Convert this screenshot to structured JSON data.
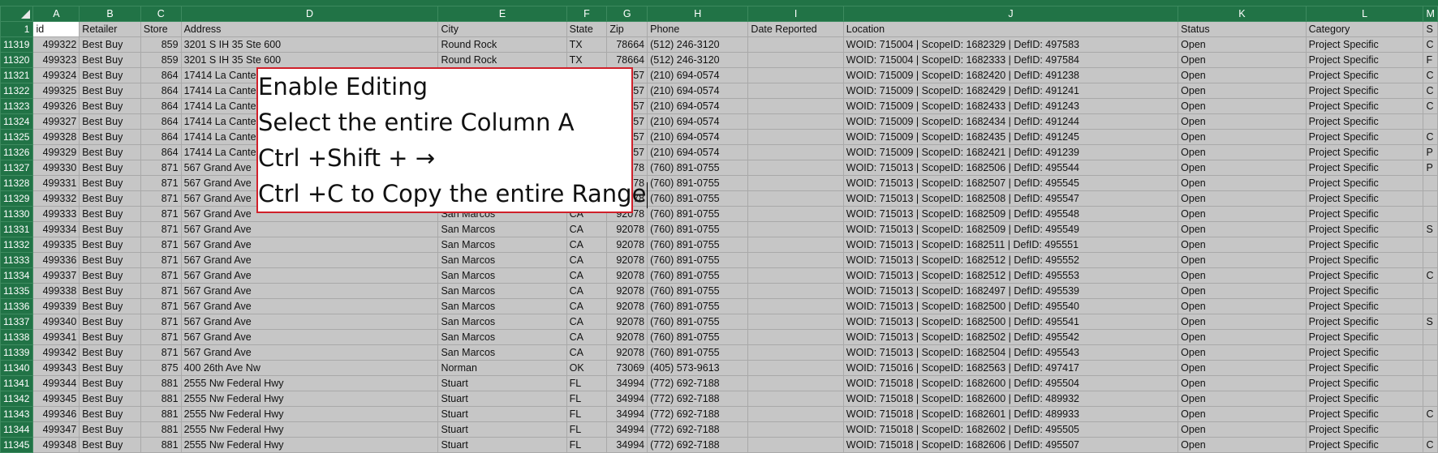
{
  "corner_label": "",
  "columns": [
    "A",
    "B",
    "C",
    "D",
    "E",
    "F",
    "G",
    "H",
    "I",
    "J",
    "K",
    "L",
    "M"
  ],
  "header_row": {
    "row_number": "1",
    "cells": [
      "id",
      "Retailer",
      "Store",
      "Address",
      "City",
      "State",
      "Zip",
      "Phone",
      "Date Reported",
      "Location",
      "Status",
      "Category",
      "S"
    ]
  },
  "rows": [
    {
      "row": "11319",
      "cells": [
        "499322",
        "Best Buy",
        "859",
        "3201 S IH 35 Ste 600",
        "Round Rock",
        "TX",
        "78664",
        "(512) 246-3120",
        "",
        "WOID: 715004 | ScopeID: 1682329 | DefID: 497583",
        "Open",
        "Project Specific",
        "C"
      ]
    },
    {
      "row": "11320",
      "cells": [
        "499323",
        "Best Buy",
        "859",
        "3201 S IH 35 Ste 600",
        "Round Rock",
        "TX",
        "78664",
        "(512) 246-3120",
        "",
        "WOID: 715004 | ScopeID: 1682333 | DefID: 497584",
        "Open",
        "Project Specific",
        "F"
      ]
    },
    {
      "row": "11321",
      "cells": [
        "499324",
        "Best Buy",
        "864",
        "17414 La Cantera",
        "",
        "",
        "78257",
        "(210) 694-0574",
        "",
        "WOID: 715009 | ScopeID: 1682420 | DefID: 491238",
        "Open",
        "Project Specific",
        "C"
      ]
    },
    {
      "row": "11322",
      "cells": [
        "499325",
        "Best Buy",
        "864",
        "17414 La Cantera",
        "",
        "",
        "78257",
        "(210) 694-0574",
        "",
        "WOID: 715009 | ScopeID: 1682429 | DefID: 491241",
        "Open",
        "Project Specific",
        "C"
      ]
    },
    {
      "row": "11323",
      "cells": [
        "499326",
        "Best Buy",
        "864",
        "17414 La Cantera",
        "",
        "",
        "78257",
        "(210) 694-0574",
        "",
        "WOID: 715009 | ScopeID: 1682433 | DefID: 491243",
        "Open",
        "Project Specific",
        "C"
      ]
    },
    {
      "row": "11324",
      "cells": [
        "499327",
        "Best Buy",
        "864",
        "17414 La Cantera",
        "",
        "",
        "78257",
        "(210) 694-0574",
        "",
        "WOID: 715009 | ScopeID: 1682434 | DefID: 491244",
        "Open",
        "Project Specific",
        ""
      ]
    },
    {
      "row": "11325",
      "cells": [
        "499328",
        "Best Buy",
        "864",
        "17414 La Cantera",
        "",
        "",
        "78257",
        "(210) 694-0574",
        "",
        "WOID: 715009 | ScopeID: 1682435 | DefID: 491245",
        "Open",
        "Project Specific",
        "C"
      ]
    },
    {
      "row": "11326",
      "cells": [
        "499329",
        "Best Buy",
        "864",
        "17414 La Cantera",
        "",
        "",
        "78257",
        "(210) 694-0574",
        "",
        "WOID: 715009 | ScopeID: 1682421 | DefID: 491239",
        "Open",
        "Project Specific",
        "P"
      ]
    },
    {
      "row": "11327",
      "cells": [
        "499330",
        "Best Buy",
        "871",
        "567 Grand Ave",
        "",
        "",
        "92078",
        "(760) 891-0755",
        "",
        "WOID: 715013 | ScopeID: 1682506 | DefID: 495544",
        "Open",
        "Project Specific",
        "P"
      ]
    },
    {
      "row": "11328",
      "cells": [
        "499331",
        "Best Buy",
        "871",
        "567 Grand Ave",
        "",
        "",
        "92078",
        "(760) 891-0755",
        "",
        "WOID: 715013 | ScopeID: 1682507 | DefID: 495545",
        "Open",
        "Project Specific",
        ""
      ]
    },
    {
      "row": "11329",
      "cells": [
        "499332",
        "Best Buy",
        "871",
        "567 Grand Ave",
        "",
        "",
        "92078",
        "(760) 891-0755",
        "",
        "WOID: 715013 | ScopeID: 1682508 | DefID: 495547",
        "Open",
        "Project Specific",
        ""
      ]
    },
    {
      "row": "11330",
      "cells": [
        "499333",
        "Best Buy",
        "871",
        "567 Grand Ave",
        "San Marcos",
        "CA",
        "92078",
        "(760) 891-0755",
        "",
        "WOID: 715013 | ScopeID: 1682509 | DefID: 495548",
        "Open",
        "Project Specific",
        ""
      ]
    },
    {
      "row": "11331",
      "cells": [
        "499334",
        "Best Buy",
        "871",
        "567 Grand Ave",
        "San Marcos",
        "CA",
        "92078",
        "(760) 891-0755",
        "",
        "WOID: 715013 | ScopeID: 1682509 | DefID: 495549",
        "Open",
        "Project Specific",
        "S"
      ]
    },
    {
      "row": "11332",
      "cells": [
        "499335",
        "Best Buy",
        "871",
        "567 Grand Ave",
        "San Marcos",
        "CA",
        "92078",
        "(760) 891-0755",
        "",
        "WOID: 715013 | ScopeID: 1682511 | DefID: 495551",
        "Open",
        "Project Specific",
        ""
      ]
    },
    {
      "row": "11333",
      "cells": [
        "499336",
        "Best Buy",
        "871",
        "567 Grand Ave",
        "San Marcos",
        "CA",
        "92078",
        "(760) 891-0755",
        "",
        "WOID: 715013 | ScopeID: 1682512 | DefID: 495552",
        "Open",
        "Project Specific",
        ""
      ]
    },
    {
      "row": "11334",
      "cells": [
        "499337",
        "Best Buy",
        "871",
        "567 Grand Ave",
        "San Marcos",
        "CA",
        "92078",
        "(760) 891-0755",
        "",
        "WOID: 715013 | ScopeID: 1682512 | DefID: 495553",
        "Open",
        "Project Specific",
        "C"
      ]
    },
    {
      "row": "11335",
      "cells": [
        "499338",
        "Best Buy",
        "871",
        "567 Grand Ave",
        "San Marcos",
        "CA",
        "92078",
        "(760) 891-0755",
        "",
        "WOID: 715013 | ScopeID: 1682497 | DefID: 495539",
        "Open",
        "Project Specific",
        ""
      ]
    },
    {
      "row": "11336",
      "cells": [
        "499339",
        "Best Buy",
        "871",
        "567 Grand Ave",
        "San Marcos",
        "CA",
        "92078",
        "(760) 891-0755",
        "",
        "WOID: 715013 | ScopeID: 1682500 | DefID: 495540",
        "Open",
        "Project Specific",
        ""
      ]
    },
    {
      "row": "11337",
      "cells": [
        "499340",
        "Best Buy",
        "871",
        "567 Grand Ave",
        "San Marcos",
        "CA",
        "92078",
        "(760) 891-0755",
        "",
        "WOID: 715013 | ScopeID: 1682500 | DefID: 495541",
        "Open",
        "Project Specific",
        "S"
      ]
    },
    {
      "row": "11338",
      "cells": [
        "499341",
        "Best Buy",
        "871",
        "567 Grand Ave",
        "San Marcos",
        "CA",
        "92078",
        "(760) 891-0755",
        "",
        "WOID: 715013 | ScopeID: 1682502 | DefID: 495542",
        "Open",
        "Project Specific",
        ""
      ]
    },
    {
      "row": "11339",
      "cells": [
        "499342",
        "Best Buy",
        "871",
        "567 Grand Ave",
        "San Marcos",
        "CA",
        "92078",
        "(760) 891-0755",
        "",
        "WOID: 715013 | ScopeID: 1682504 | DefID: 495543",
        "Open",
        "Project Specific",
        ""
      ]
    },
    {
      "row": "11340",
      "cells": [
        "499343",
        "Best Buy",
        "875",
        "400 26th Ave Nw",
        "Norman",
        "OK",
        "73069",
        "(405) 573-9613",
        "",
        "WOID: 715016 | ScopeID: 1682563 | DefID: 497417",
        "Open",
        "Project Specific",
        ""
      ]
    },
    {
      "row": "11341",
      "cells": [
        "499344",
        "Best Buy",
        "881",
        "2555 Nw Federal Hwy",
        "Stuart",
        "FL",
        "34994",
        "(772) 692-7188",
        "",
        "WOID: 715018 | ScopeID: 1682600 | DefID: 495504",
        "Open",
        "Project Specific",
        ""
      ]
    },
    {
      "row": "11342",
      "cells": [
        "499345",
        "Best Buy",
        "881",
        "2555 Nw Federal Hwy",
        "Stuart",
        "FL",
        "34994",
        "(772) 692-7188",
        "",
        "WOID: 715018 | ScopeID: 1682600 | DefID: 489932",
        "Open",
        "Project Specific",
        ""
      ]
    },
    {
      "row": "11343",
      "cells": [
        "499346",
        "Best Buy",
        "881",
        "2555 Nw Federal Hwy",
        "Stuart",
        "FL",
        "34994",
        "(772) 692-7188",
        "",
        "WOID: 715018 | ScopeID: 1682601 | DefID: 489933",
        "Open",
        "Project Specific",
        "C"
      ]
    },
    {
      "row": "11344",
      "cells": [
        "499347",
        "Best Buy",
        "881",
        "2555 Nw Federal Hwy",
        "Stuart",
        "FL",
        "34994",
        "(772) 692-7188",
        "",
        "WOID: 715018 | ScopeID: 1682602 | DefID: 495505",
        "Open",
        "Project Specific",
        ""
      ]
    },
    {
      "row": "11345",
      "cells": [
        "499348",
        "Best Buy",
        "881",
        "2555 Nw Federal Hwy",
        "Stuart",
        "FL",
        "34994",
        "(772) 692-7188",
        "",
        "WOID: 715018 | ScopeID: 1682606 | DefID: 495507",
        "Open",
        "Project Specific",
        "C"
      ]
    }
  ],
  "numeric_columns": [
    0,
    2,
    6
  ],
  "instructions": {
    "line1": "Enable Editing",
    "line2": "Select the entire Column A",
    "line3": "Ctrl +Shift +  →",
    "line4": "Ctrl +C to Copy the entire Range"
  },
  "colors": {
    "header_green": "#217346",
    "selection_gray": "#c6c6c6",
    "callout_border": "#d0202a"
  }
}
